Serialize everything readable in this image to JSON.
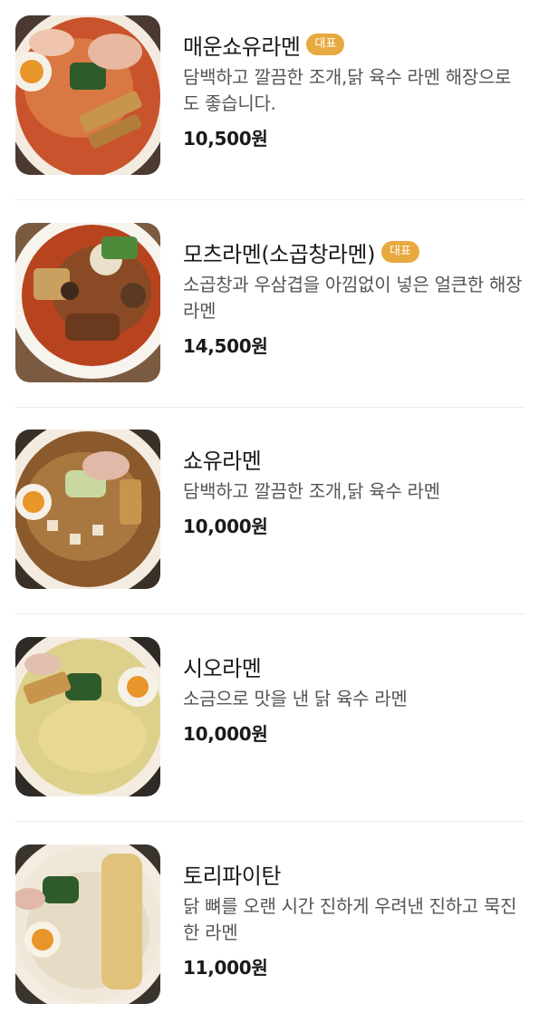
{
  "menu": {
    "items": [
      {
        "name": "매운쇼유라멘",
        "badge": "대표",
        "description": "담백하고 깔끔한 조개,닭 육수 라멘 해장으로도 좋습니다.",
        "price": "10,500원",
        "image": "spicy-shoyu-ramen-photo"
      },
      {
        "name": "모츠라멘(소곱창라멘)",
        "badge": "대표",
        "description": "소곱창과 우삼겹을 아낌없이 넣은 얼큰한 해장라멘",
        "price": "14,500원",
        "image": "motsu-ramen-photo"
      },
      {
        "name": "쇼유라멘",
        "description": "담백하고 깔끔한 조개,닭 육수 라멘",
        "price": "10,000원",
        "image": "shoyu-ramen-photo"
      },
      {
        "name": "시오라멘",
        "description": "소금으로 맛을 낸 닭 육수 라멘",
        "price": "10,000원",
        "image": "shio-ramen-photo"
      },
      {
        "name": "토리파이탄",
        "description": "닭 뼈를 오랜 시간 진하게 우려낸 진하고 묵진한 라멘",
        "price": "11,000원",
        "image": "tori-paitan-photo"
      }
    ]
  },
  "colors": {
    "badge": "#e8a93f",
    "divider": "#ececec",
    "name_text": "#1a1a1a",
    "desc_text": "#555555"
  }
}
